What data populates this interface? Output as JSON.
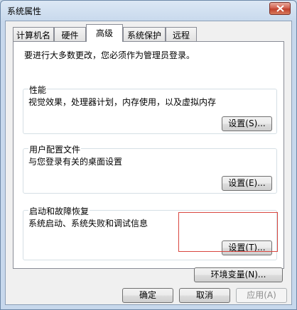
{
  "window": {
    "title": "系统属性"
  },
  "tabs": [
    {
      "label": "计算机名"
    },
    {
      "label": "硬件"
    },
    {
      "label": "高级"
    },
    {
      "label": "系统保护"
    },
    {
      "label": "远程"
    }
  ],
  "active_tab": "高级",
  "notice": "要进行大多数更改，您必须作为管理员登录。",
  "groups": {
    "performance": {
      "title": "性能",
      "description": "视觉效果，处理器计划，内存使用，以及虚拟内存",
      "button": "设置(S)..."
    },
    "user_profiles": {
      "title": "用户配置文件",
      "description": "与您登录有关的桌面设置",
      "button": "设置(E)..."
    },
    "startup_recovery": {
      "title": "启动和故障恢复",
      "description": "系统启动、系统失败和调试信息",
      "button": "设置(T)..."
    }
  },
  "env_button": "环境变量(N)...",
  "footer": {
    "ok": "确定",
    "cancel": "取消",
    "apply": "应用(A)"
  },
  "colors": {
    "highlight_box": "#d9463f",
    "close_button": "#c0402c"
  }
}
